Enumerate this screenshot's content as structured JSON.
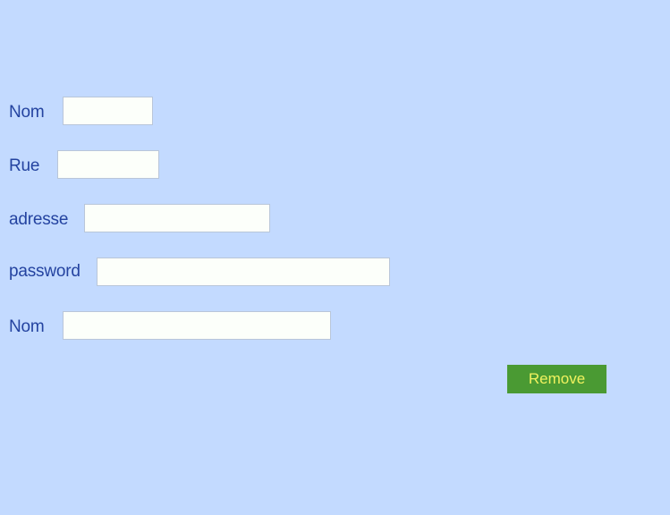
{
  "form": {
    "fields": [
      {
        "label": "Nom",
        "value": "",
        "placeholder": ""
      },
      {
        "label": "Rue",
        "value": "",
        "placeholder": ""
      },
      {
        "label": "adresse",
        "value": "",
        "placeholder": ""
      },
      {
        "label": "password",
        "value": "",
        "placeholder": ""
      },
      {
        "label": "Nom",
        "value": "",
        "placeholder": ""
      }
    ],
    "remove_label": "Remove"
  },
  "colors": {
    "background": "#c3daff",
    "label_text": "#2443a0",
    "field_background": "#fcfffa",
    "field_border": "#b9c6d9",
    "button_background": "#4a9a33",
    "button_text": "#f1f25f"
  }
}
